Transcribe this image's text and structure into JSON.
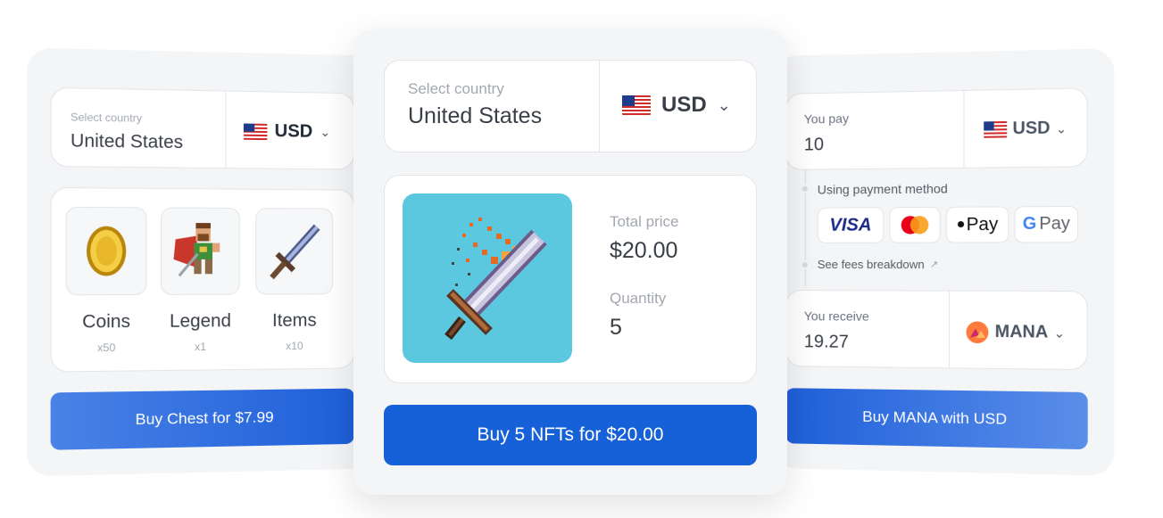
{
  "left_card": {
    "country_label": "Select country",
    "country_value": "United States",
    "currency": "USD",
    "items": [
      {
        "name": "Coins",
        "count": "x50",
        "icon": "coin-icon"
      },
      {
        "name": "Legend",
        "count": "x1",
        "icon": "legend-hero-icon"
      },
      {
        "name": "Items",
        "count": "x10",
        "icon": "sword-icon"
      }
    ],
    "button_label": "Buy Chest for $7.99"
  },
  "center_card": {
    "country_label": "Select country",
    "country_value": "United States",
    "currency": "USD",
    "total_price_label": "Total price",
    "total_price_value": "$20.00",
    "quantity_label": "Quantity",
    "quantity_value": "5",
    "nft_image": "flaming-sword-icon",
    "button_label": "Buy 5 NFTs for $20.00"
  },
  "right_card": {
    "pay_label": "You pay",
    "pay_value": "10",
    "pay_currency": "USD",
    "payment_method_label": "Using payment method",
    "payment_methods": {
      "visa": "VISA",
      "apple": "Pay",
      "google_g": "G",
      "google": "Pay"
    },
    "fees_label": "See fees breakdown",
    "receive_label": "You receive",
    "receive_value": "19.27",
    "receive_currency": "MANA",
    "button_label": "Buy MANA with USD"
  },
  "colors": {
    "primary": "#1660d8",
    "nft_bg": "#5bc8e0",
    "mana": "#f2543c"
  }
}
